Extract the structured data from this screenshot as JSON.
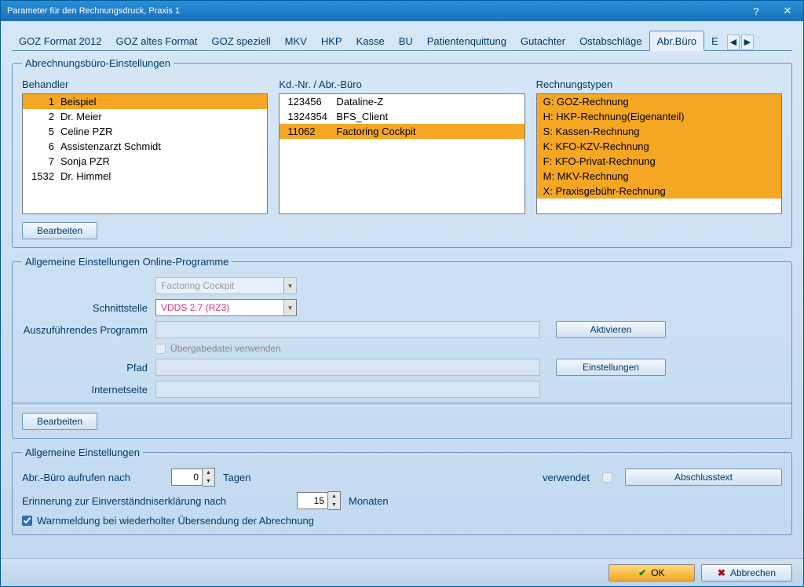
{
  "window": {
    "title": "Parameter für den Rechnungsdruck, Praxis 1"
  },
  "tabs": {
    "items": [
      "GOZ Format 2012",
      "GOZ altes Format",
      "GOZ speziell",
      "MKV",
      "HKP",
      "Kasse",
      "BU",
      "Patientenquittung",
      "Gutachter",
      "Ostabschläge",
      "Abr.Büro",
      "E"
    ],
    "active": "Abr.Büro"
  },
  "group1": {
    "legend": "Abrechnungsbüro-Einstellungen",
    "behandler_label": "Behandler",
    "behandler": [
      {
        "num": "1",
        "name": "Beispiel",
        "sel": true
      },
      {
        "num": "2",
        "name": "Dr. Meier"
      },
      {
        "num": "5",
        "name": "Celine PZR"
      },
      {
        "num": "6",
        "name": "Assistenzarzt Schmidt"
      },
      {
        "num": "7",
        "name": "Sonja PZR"
      },
      {
        "num": "1532",
        "name": "Dr. Himmel"
      }
    ],
    "kd_label": "Kd.-Nr. / Abr.-Büro",
    "kd": [
      {
        "num": "123456",
        "name": "Dataline-Z"
      },
      {
        "num": "1324354",
        "name": "BFS_Client"
      },
      {
        "num": "11062",
        "name": "Factoring Cockpit",
        "sel": true
      }
    ],
    "types_label": "Rechnungstypen",
    "types": [
      {
        "t": "G:  GOZ-Rechnung",
        "sel": true
      },
      {
        "t": "H:  HKP-Rechnung(Eigenanteil)",
        "sel": true
      },
      {
        "t": "S:  Kassen-Rechnung",
        "sel": true
      },
      {
        "t": "K:  KFO-KZV-Rechnung",
        "sel": true
      },
      {
        "t": "F:  KFO-Privat-Rechnung",
        "sel": true
      },
      {
        "t": "M:  MKV-Rechnung",
        "sel": true
      },
      {
        "t": "X:  Praxisgebühr-Rechnung",
        "sel": true
      }
    ],
    "edit": "Bearbeiten"
  },
  "group2": {
    "legend": "Allgemeine Einstellungen Online-Programme",
    "program_select": "Factoring Cockpit",
    "schnittstelle_label": "Schnittstelle",
    "schnittstelle_value": "VDDS 2.7 (RZ3)",
    "exec_label": "Auszuführendes Programm",
    "chk_transfer": "Übergabedatei verwenden",
    "pfad_label": "Pfad",
    "inet_label": "Internetseite",
    "activate": "Aktivieren",
    "settings": "Einstellungen",
    "edit": "Bearbeiten"
  },
  "group3": {
    "legend": "Allgemeine Einstellungen",
    "call_label": "Abr.-Büro aufrufen nach",
    "call_value": "0",
    "call_unit": "Tagen",
    "used_label": "verwendet",
    "abs_btn": "Abschlusstext",
    "reminder_label": "Erinnerung zur Einverständniserklärung nach",
    "reminder_value": "15",
    "reminder_unit": "Monaten",
    "warn_label": "Warnmeldung bei wiederholter Übersendung der Abrechnung"
  },
  "footer": {
    "ok": "OK",
    "cancel": "Abbrechen"
  }
}
